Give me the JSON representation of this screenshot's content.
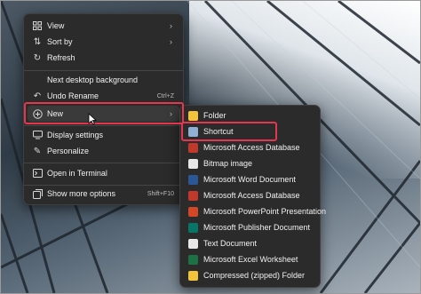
{
  "context_menu": {
    "items": [
      {
        "label": "View",
        "icon": "view-grid-icon"
      },
      {
        "label": "Sort by",
        "icon": "sort-icon"
      },
      {
        "label": "Refresh",
        "icon": "refresh-icon"
      },
      {
        "label": "Next desktop background",
        "icon": ""
      },
      {
        "label": "Undo Rename",
        "shortcut": "Ctrl+Z",
        "icon": "undo-icon"
      },
      {
        "label": "New",
        "icon": "new-plus-icon"
      },
      {
        "label": "Display settings",
        "icon": "display-icon"
      },
      {
        "label": "Personalize",
        "icon": "brush-icon"
      },
      {
        "label": "Open in Terminal",
        "icon": "terminal-icon"
      },
      {
        "label": "Show more options",
        "shortcut": "Shift+F10",
        "icon": "more-options-icon"
      }
    ]
  },
  "new_submenu": {
    "items": [
      {
        "label": "Folder",
        "icon": "folder-icon",
        "color": "#f3c33b"
      },
      {
        "label": "Shortcut",
        "icon": "shortcut-icon",
        "color": "#8fb0d4"
      },
      {
        "label": "Microsoft Access Database",
        "icon": "access-icon",
        "color": "#c0392b"
      },
      {
        "label": "Bitmap image",
        "icon": "bitmap-icon",
        "color": "#e8e8e8"
      },
      {
        "label": "Microsoft Word Document",
        "icon": "word-icon",
        "color": "#2b5797"
      },
      {
        "label": "Microsoft Access Database",
        "icon": "access-icon",
        "color": "#c0392b"
      },
      {
        "label": "Microsoft PowerPoint Presentation",
        "icon": "powerpoint-icon",
        "color": "#d24726"
      },
      {
        "label": "Microsoft Publisher Document",
        "icon": "publisher-icon",
        "color": "#077568"
      },
      {
        "label": "Text Document",
        "icon": "text-document-icon",
        "color": "#e8e8e8"
      },
      {
        "label": "Microsoft Excel Worksheet",
        "icon": "excel-icon",
        "color": "#1e7145"
      },
      {
        "label": "Compressed (zipped) Folder",
        "icon": "zip-folder-icon",
        "color": "#f3c33b"
      }
    ]
  },
  "accent_color": "#e5364f"
}
